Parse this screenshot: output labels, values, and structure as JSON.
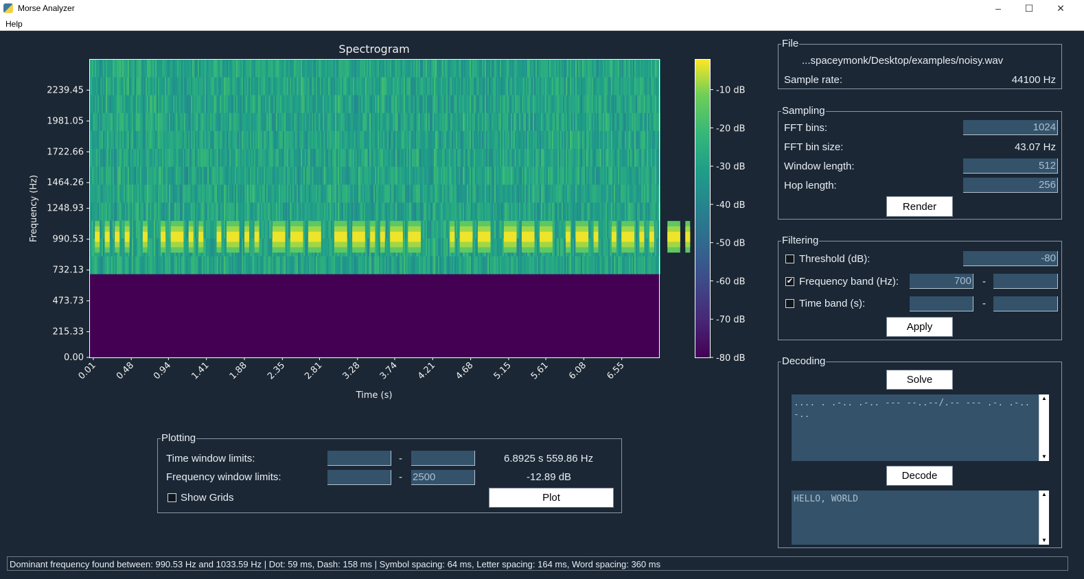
{
  "window": {
    "title": "Morse Analyzer",
    "menu": [
      "Help"
    ]
  },
  "chart_data": {
    "type": "heatmap",
    "title": "Spectrogram",
    "xlabel": "Time (s)",
    "ylabel": "Frequency (Hz)",
    "xlim": [
      -0.04,
      7.02
    ],
    "ylim": [
      0,
      2500
    ],
    "x_ticks": [
      "0.01",
      "0.48",
      "0.94",
      "1.41",
      "1.88",
      "2.35",
      "2.81",
      "3.28",
      "3.74",
      "4.21",
      "4.68",
      "5.15",
      "5.61",
      "6.08",
      "6.55"
    ],
    "y_ticks": [
      "0.00",
      "215.33",
      "473.73",
      "732.13",
      "990.53",
      "1248.93",
      "1464.26",
      "1722.66",
      "1981.05",
      "2239.45"
    ],
    "colorbar": {
      "range_db": [
        -80,
        -2
      ],
      "ticks": [
        "-10 dB",
        "-20 dB",
        "-30 dB",
        "-40 dB",
        "-50 dB",
        "-60 dB",
        "-70 dB",
        "-80 dB"
      ],
      "colormap": "viridis"
    },
    "filtered_below_hz": 700,
    "tone_band_hz": [
      878,
      1143
    ],
    "tone_peak_db": -3,
    "noise_db_range": [
      -40,
      -18
    ],
    "tone_start_s": 0.03,
    "grid": false
  },
  "file": {
    "title": "File",
    "path": "...spaceymonk/Desktop/examples/noisy.wav",
    "sample_rate_label": "Sample rate:",
    "sample_rate": "44100 Hz"
  },
  "sampling": {
    "title": "Sampling",
    "fft_bins_label": "FFT bins:",
    "fft_bins": "1024",
    "bin_size_label": "FFT bin size:",
    "bin_size": "43.07 Hz",
    "window_label": "Window length:",
    "window": "512",
    "hop_label": "Hop length:",
    "hop": "256",
    "render": "Render"
  },
  "filtering": {
    "title": "Filtering",
    "threshold_label": "Threshold (dB):",
    "threshold": "-80",
    "threshold_checked": false,
    "freq_label": "Frequency band (Hz):",
    "freq_min": "700",
    "freq_max": "",
    "freq_checked": true,
    "time_label": "Time band (s):",
    "time_min": "",
    "time_max": "",
    "time_checked": false,
    "dash": "-",
    "apply": "Apply"
  },
  "decoding": {
    "title": "Decoding",
    "solve": "Solve",
    "morse": ".... . .-.. .-.. --- --..--/.-- --- .-. .-.. -..",
    "decode": "Decode",
    "text": "HELLO, WORLD"
  },
  "plotting": {
    "title": "Plotting",
    "time_label": "Time window limits:",
    "time_min": "",
    "time_max": "",
    "freq_label": "Frequency window limits:",
    "freq_min": "",
    "freq_max": "2500",
    "dash": "-",
    "cursor_pos": "6.8925 s  559.86 Hz",
    "cursor_val": "-12.89 dB",
    "grids_label": "Show Grids",
    "grids_checked": false,
    "plot": "Plot"
  },
  "status": {
    "text": "Dominant frequency found between: 990.53 Hz and 1033.59 Hz | Dot: 59 ms, Dash: 158 ms | Symbol spacing: 64 ms, Letter spacing: 164 ms, Word spacing: 360 ms",
    "dot_ms": 59,
    "dash_ms": 158,
    "symbol_ms": 64,
    "letter_ms": 164,
    "word_ms": 360
  },
  "colors": {
    "background": "#1b2735",
    "input": "#34526a"
  }
}
